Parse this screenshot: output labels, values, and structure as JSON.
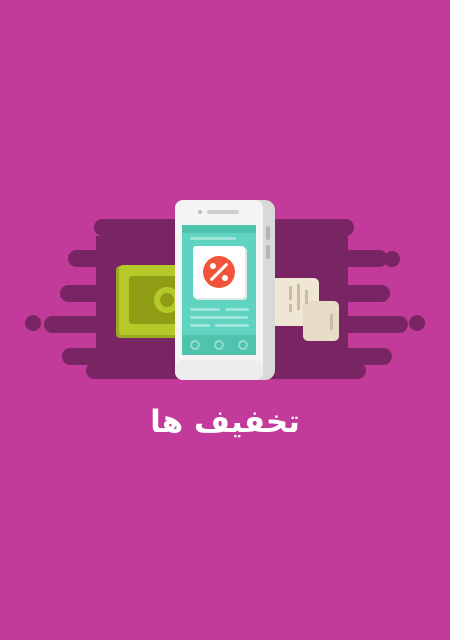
{
  "screen": {
    "title": "تخفیف ها",
    "background_color": "#c23a9a"
  },
  "illustration": {
    "icons": [
      "phone-icon",
      "percent-badge-icon",
      "banknote-icon",
      "receipt-icon"
    ],
    "colors": {
      "shadow_streaks": "#7a2563",
      "phone_body": "#f4f4f4",
      "phone_screen": "#5fd3bf",
      "percent_badge": "#f2543a",
      "banknote": "#b6c92b",
      "receipt": "#efe6d3"
    }
  }
}
